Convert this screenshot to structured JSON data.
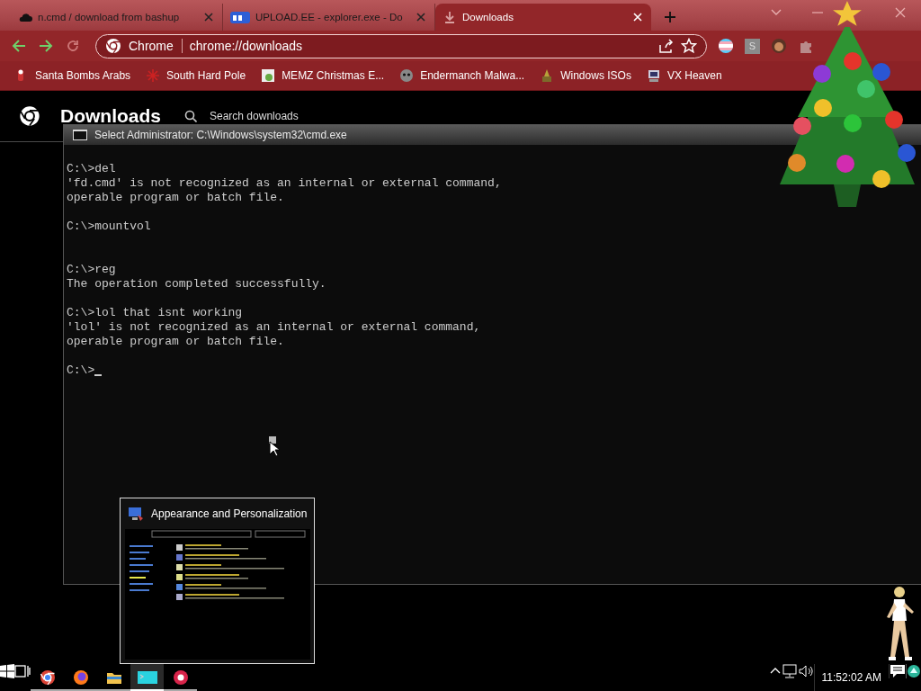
{
  "tabs": [
    {
      "title": "n.cmd / download from bashup",
      "selected": false
    },
    {
      "title": "UPLOAD.EE - explorer.exe - Do",
      "selected": false
    },
    {
      "title": "Downloads",
      "selected": true
    }
  ],
  "address_bar": {
    "site_chip": "Chrome",
    "url": "chrome://downloads"
  },
  "extension_letter": "S",
  "bookmarks": [
    "Santa Bombs Arabs",
    "South Hard Pole",
    "MEMZ Christmas E...",
    "Endermanch Malwa...",
    "Windows ISOs",
    "VX Heaven"
  ],
  "downloads_page": {
    "title": "Downloads",
    "search": {
      "placeholder": "Search downloads"
    }
  },
  "console_window": {
    "title": "Select Administrator: C:\\Windows\\system32\\cmd.exe",
    "blocks": [
      {
        "lines": [
          "C:\\>del",
          "'fd.cmd' is not recognized as an internal or external command,",
          "operable program or batch file."
        ]
      },
      {
        "lines": [
          "C:\\>mountvol"
        ],
        "extra_blank_line": true
      },
      {
        "lines": [
          "C:\\>reg",
          "The operation completed successfully."
        ]
      },
      {
        "lines": [
          "C:\\>lol that isnt working",
          "'lol' is not recognized as an internal or external command,",
          "operable program or batch file."
        ]
      },
      {
        "lines": [
          "C:\\>"
        ],
        "cursor": true
      }
    ]
  },
  "taskbar_preview": {
    "title": "Appearance and Personalization"
  },
  "taskbar": {
    "apps": [
      {
        "selected": false
      },
      {
        "selected": false
      },
      {
        "selected": false
      },
      {
        "selected": true
      },
      {
        "selected": false
      }
    ],
    "clock": "11:52:02 AM"
  }
}
